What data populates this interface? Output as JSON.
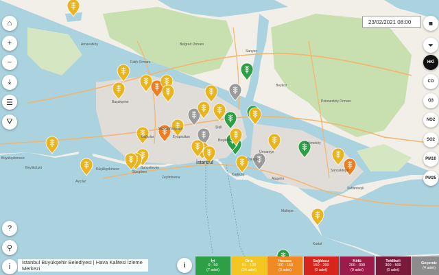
{
  "controls_left": [
    {
      "name": "home-icon",
      "glyph": "⌂"
    },
    {
      "name": "zoom-in-icon",
      "glyph": "+"
    },
    {
      "name": "zoom-out-icon",
      "glyph": "−"
    },
    {
      "name": "download-icon",
      "glyph": "⤓"
    },
    {
      "name": "list-icon",
      "glyph": "☰"
    },
    {
      "name": "road-icon",
      "glyph": "⛛"
    }
  ],
  "controls_left_bottom": [
    {
      "name": "help-icon",
      "glyph": "?"
    },
    {
      "name": "search-icon",
      "glyph": "⚲"
    },
    {
      "name": "info-icon",
      "glyph": "i"
    }
  ],
  "date": {
    "value": "23/02/2021 08:00"
  },
  "attribution": "İstanbul Büyükşehir Belediyesi | Hava Kalitesi İzleme Merkezi",
  "pollutants": [
    "HKİ",
    "CO",
    "O3",
    "NO2",
    "SO2",
    "PM10",
    "PM25"
  ],
  "active_pollutant": "HKİ",
  "legend": [
    {
      "name": "İyi",
      "range": "0 - 50",
      "count": "(7 adet)",
      "color": "#2e9e47"
    },
    {
      "name": "Orta",
      "range": "51 - 100",
      "count": "(24 adet)",
      "color": "#f3c623"
    },
    {
      "name": "Hassas",
      "range": "100 - 150",
      "count": "(3 adet)",
      "color": "#f08a24"
    },
    {
      "name": "Sağlıksız",
      "range": "150 - 200",
      "count": "(0 adet)",
      "color": "#d7251c"
    },
    {
      "name": "Kötü",
      "range": "200 - 300",
      "count": "(0 adet)",
      "color": "#9b1c48"
    },
    {
      "name": "Tehlikeli",
      "range": "300 - 500",
      "count": "(0 adet)",
      "color": "#7a1a3a"
    },
    {
      "name": "Geçersiz",
      "range": "",
      "count": "(4 adet)",
      "color": "#8c8c8c"
    }
  ],
  "map_labels": [
    {
      "text": "Arnavutköy"
    },
    {
      "text": "Belgrad Ormanı"
    },
    {
      "text": "Sarıyer"
    },
    {
      "text": "Beykoz"
    },
    {
      "text": "Fatih Ormanı"
    },
    {
      "text": "Başakşehir"
    },
    {
      "text": "Gaziosmanpaşa"
    },
    {
      "text": "Eyüpsultan"
    },
    {
      "text": "Şişli"
    },
    {
      "text": "Polonezköy Ormanı"
    },
    {
      "text": "Bağcılar"
    },
    {
      "text": "Güngören"
    },
    {
      "text": "Bahçelievler"
    },
    {
      "text": "Büyükçekmece"
    },
    {
      "text": "Küçükçekmece"
    },
    {
      "text": "İstanbul"
    },
    {
      "text": "Beşiktaş"
    },
    {
      "text": "Üsküdar"
    },
    {
      "text": "Ümraniye"
    },
    {
      "text": "Çekmeköy"
    },
    {
      "text": "Sancaktepe"
    },
    {
      "text": "Sultanbeyli"
    },
    {
      "text": "Kadıköy"
    },
    {
      "text": "Ataşehir"
    },
    {
      "text": "Maltepe"
    },
    {
      "text": "Kartal"
    },
    {
      "text": "Avcılar"
    },
    {
      "text": "Beylikdüzü"
    },
    {
      "text": "Zeytinburnu"
    }
  ],
  "markers": [
    {
      "level": "orta"
    },
    {
      "level": "orta"
    },
    {
      "level": "orta"
    },
    {
      "level": "orta"
    },
    {
      "level": "hassas"
    },
    {
      "level": "orta"
    },
    {
      "level": "orta"
    },
    {
      "level": "gecersiz"
    },
    {
      "level": "orta"
    },
    {
      "level": "orta"
    },
    {
      "level": "gecersiz"
    },
    {
      "level": "iyi"
    },
    {
      "level": "iyi"
    },
    {
      "level": "orta"
    },
    {
      "level": "iyi"
    },
    {
      "level": "gecersiz"
    },
    {
      "level": "orta"
    },
    {
      "level": "orta"
    },
    {
      "level": "hassas"
    },
    {
      "level": "orta"
    },
    {
      "level": "gecersiz"
    },
    {
      "level": "orta"
    },
    {
      "level": "iyi"
    },
    {
      "level": "iyi"
    },
    {
      "level": "orta"
    },
    {
      "level": "orta"
    },
    {
      "level": "orta"
    },
    {
      "level": "orta"
    },
    {
      "level": "orta"
    },
    {
      "level": "orta"
    },
    {
      "level": "orta"
    },
    {
      "level": "orta"
    },
    {
      "level": "orta"
    },
    {
      "level": "iyi"
    },
    {
      "level": "orta"
    },
    {
      "level": "hassas"
    },
    {
      "level": "orta"
    },
    {
      "level": "iyi"
    },
    {
      "level": "orta"
    }
  ],
  "level_colors": {
    "iyi": "#2e9e47",
    "orta": "#e8b520",
    "hassas": "#ec7f23",
    "gecersiz": "#9a9a9a"
  }
}
